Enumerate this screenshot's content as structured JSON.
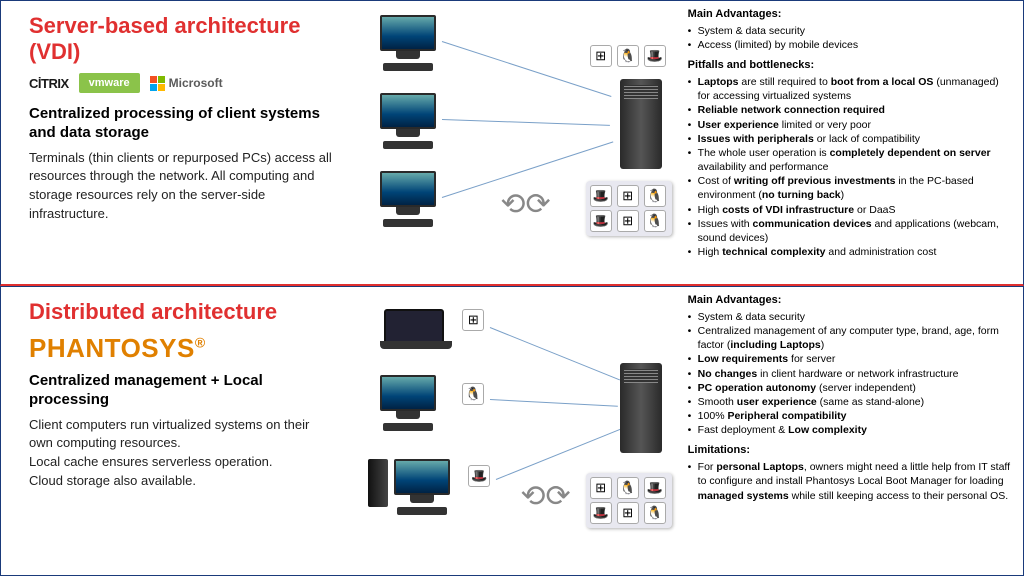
{
  "top": {
    "title": "Server-based architecture (VDI)",
    "vendors": {
      "citrix": "CİTRIX",
      "vmware": "vmware",
      "microsoft": "Microsoft"
    },
    "sub": "Centralized processing of client systems and data storage",
    "desc": "Terminals (thin clients or repurposed PCs) access all resources through the network. All computing and storage resources rely on the server-side infrastructure.",
    "adv_h": "Main Advantages:",
    "adv": [
      "System & data security",
      "Access (limited) by mobile devices"
    ],
    "pit_h": "Pitfalls and bottlenecks:",
    "pit": [
      "<b>Laptops</b> are still required to <b>boot from a local OS</b> (unmanaged) for accessing virtualized systems",
      "<b>Reliable network connection required</b>",
      "<b>User experience</b> limited or very poor",
      "<b>Issues with peripherals</b> or lack of compatibility",
      "The whole user operation is <b>completely dependent on server</b> availability and performance",
      "Cost of <b>writing off previous investments</b> in the PC-based environment (<b>no turning back</b>)",
      "High <b>costs of VDI infrastructure</b> or DaaS",
      "Issues with <b>communication devices</b> and applications (webcam, sound devices)",
      "High <b>technical complexity</b> and administration cost"
    ]
  },
  "bottom": {
    "title": "Distributed architecture",
    "brand": "PHANTOSYS",
    "sub": "Centralized management + Local processing",
    "desc": "Client computers run virtualized systems on their own computing resources.\nLocal cache ensures serverless operation.\nCloud storage also available.",
    "adv_h": "Main Advantages:",
    "adv": [
      "System & data security",
      "Centralized management of any computer type, brand, age, form factor (<b>including Laptops</b>)",
      "<b>Low requirements</b> for server",
      "<b>No changes</b> in client hardware or network infrastructure",
      "<b>PC operation autonomy</b> (server independent)",
      "Smooth <b>user experience</b> (same as stand-alone)",
      "100% <b>Peripheral compatibility</b>",
      "Fast deployment & <b>Low complexity</b>"
    ],
    "lim_h": "Limitations:",
    "lim": [
      "For <b>personal Laptops</b>, owners might need a little help from IT staff to configure and install Phantosys Local Boot Manager for loading <b>managed systems</b> while still keeping access to their personal OS."
    ]
  },
  "icons": {
    "win": "⊞",
    "linux": "🐧",
    "redhat": "🎩"
  }
}
